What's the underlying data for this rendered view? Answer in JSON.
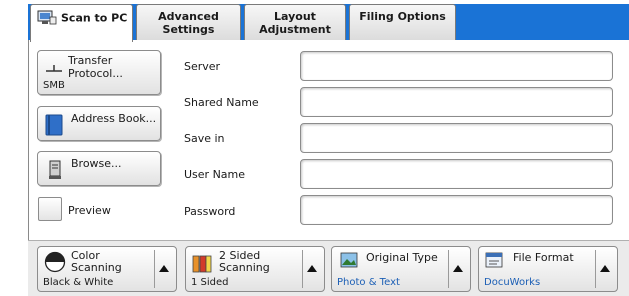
{
  "tabs": [
    {
      "label": "Scan to PC",
      "active": true
    },
    {
      "label": "Advanced\nSettings",
      "active": false
    },
    {
      "label": "Layout\nAdjustment",
      "active": false
    },
    {
      "label": "Filing Options",
      "active": false
    }
  ],
  "left_buttons": {
    "transfer_protocol": {
      "label": "Transfer\nProtocol...",
      "value": "SMB"
    },
    "address_book": {
      "label": "Address Book..."
    },
    "browse": {
      "label": "Browse..."
    }
  },
  "preview": {
    "label": "Preview",
    "checked": false
  },
  "fields": [
    {
      "label": "Server",
      "value": ""
    },
    {
      "label": "Shared Name",
      "value": ""
    },
    {
      "label": "Save in",
      "value": ""
    },
    {
      "label": "User Name",
      "value": ""
    },
    {
      "label": "Password",
      "value": ""
    }
  ],
  "bottom_buttons": [
    {
      "label": "Color\nScanning",
      "value": "Black & White",
      "icon": "color-scanning-icon"
    },
    {
      "label": "2 Sided\nScanning",
      "value": "1 Sided",
      "icon": "two-sided-icon"
    },
    {
      "label": "Original Type",
      "value": "Photo & Text",
      "icon": "original-type-icon"
    },
    {
      "label": "File Format",
      "value": "DocuWorks",
      "icon": "file-format-icon"
    }
  ],
  "colors": {
    "tab_bar": "#1a73d6",
    "value_text": "#1c5fb5"
  }
}
